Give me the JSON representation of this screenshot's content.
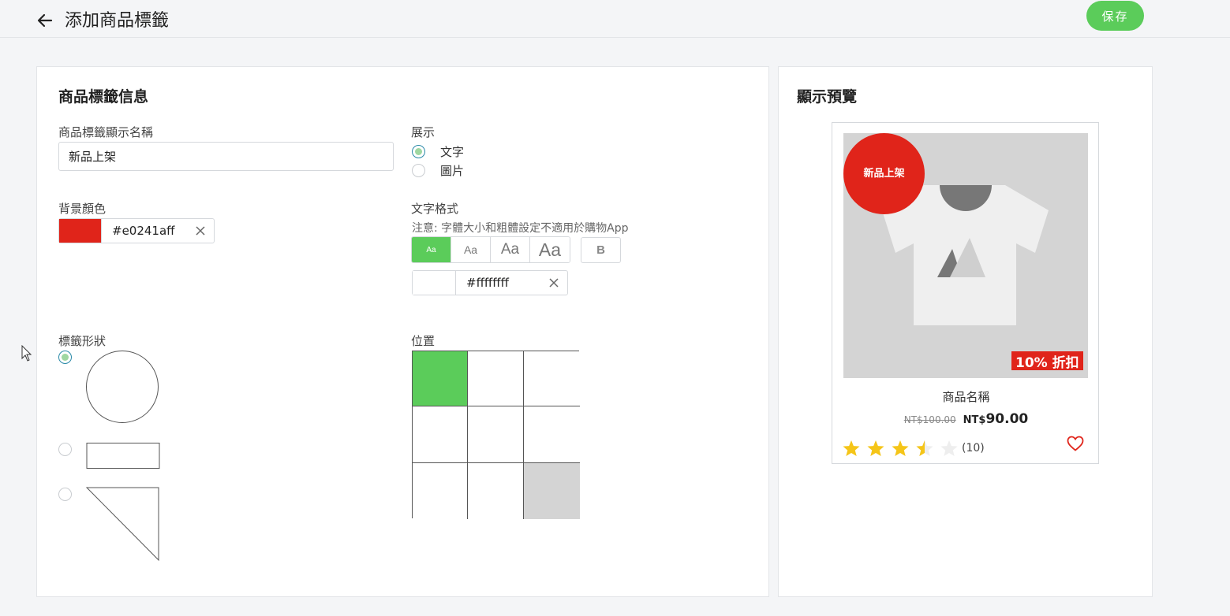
{
  "header": {
    "back_icon": "arrow-left-icon",
    "title": "添加商品標籤",
    "save_label": "保存",
    "accent_color": "#5bcc5a"
  },
  "form": {
    "section_title": "商品標籤信息",
    "name_field": {
      "label": "商品標籤顯示名稱",
      "value": "新品上架"
    },
    "display": {
      "label": "展示",
      "options": [
        {
          "label": "文字",
          "selected": true
        },
        {
          "label": "圖片",
          "selected": false
        }
      ]
    },
    "background_color": {
      "label": "背景顏色",
      "swatch": "#e0241a",
      "value": "#e0241aff"
    },
    "text_format": {
      "label": "文字格式",
      "note": "注意: 字體大小和粗體設定不適用於購物App",
      "sizes": [
        {
          "label": "Aa",
          "active": true
        },
        {
          "label": "Aa",
          "active": false
        },
        {
          "label": "Aa",
          "active": false
        },
        {
          "label": "Aa",
          "active": false
        }
      ],
      "bold_label": "B",
      "color_swatch": "#ffffff",
      "color_value": "#ffffffff"
    },
    "shape": {
      "label": "標籤形狀",
      "options": [
        "circle",
        "rectangle",
        "triangle"
      ],
      "selected": "circle"
    },
    "position": {
      "label": "位置",
      "selected_cell": "top-left",
      "disabled_cell": "bottom-right"
    }
  },
  "preview": {
    "section_title": "顯示預覽",
    "tag_text": "新品上架",
    "discount_badge": "10% 折扣",
    "product_name": "商品名稱",
    "old_price": "NT$100.00",
    "currency": "NT$",
    "new_price": "90.00",
    "rating": 3.5,
    "rating_max": 5,
    "review_count": "(10)",
    "star_color": "#f5c518",
    "heart_color": "#e0241a"
  }
}
